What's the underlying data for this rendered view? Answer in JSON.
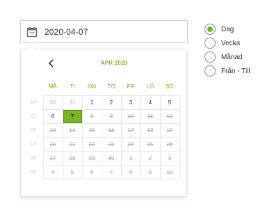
{
  "date_input": {
    "value": "2020-04-07",
    "icon": "calendar-icon"
  },
  "calendar": {
    "month_label": "APR 2020",
    "prev_icon": "chevron-left-icon",
    "weekday_headers": [
      "MÅ",
      "TI",
      "ON",
      "TO",
      "FR",
      "LÖ",
      "SÖ"
    ],
    "weeks": [
      {
        "week": "14",
        "days": [
          {
            "d": "30",
            "state": "other"
          },
          {
            "d": "31",
            "state": "other"
          },
          {
            "d": "1",
            "state": "normal"
          },
          {
            "d": "2",
            "state": "normal"
          },
          {
            "d": "3",
            "state": "normal"
          },
          {
            "d": "4",
            "state": "normal"
          },
          {
            "d": "5",
            "state": "normal"
          }
        ]
      },
      {
        "week": "15",
        "days": [
          {
            "d": "6",
            "state": "normal"
          },
          {
            "d": "7",
            "state": "selected"
          },
          {
            "d": "8",
            "state": "disabled"
          },
          {
            "d": "9",
            "state": "disabled"
          },
          {
            "d": "10",
            "state": "disabled"
          },
          {
            "d": "11",
            "state": "disabled"
          },
          {
            "d": "12",
            "state": "disabled"
          }
        ]
      },
      {
        "week": "16",
        "days": [
          {
            "d": "13",
            "state": "disabled"
          },
          {
            "d": "14",
            "state": "disabled"
          },
          {
            "d": "15",
            "state": "disabled"
          },
          {
            "d": "16",
            "state": "disabled"
          },
          {
            "d": "17",
            "state": "disabled"
          },
          {
            "d": "18",
            "state": "disabled"
          },
          {
            "d": "19",
            "state": "disabled"
          }
        ]
      },
      {
        "week": "17",
        "days": [
          {
            "d": "20",
            "state": "disabled"
          },
          {
            "d": "21",
            "state": "disabled"
          },
          {
            "d": "22",
            "state": "disabled"
          },
          {
            "d": "23",
            "state": "disabled"
          },
          {
            "d": "24",
            "state": "disabled"
          },
          {
            "d": "25",
            "state": "disabled"
          },
          {
            "d": "26",
            "state": "disabled"
          }
        ]
      },
      {
        "week": "18",
        "days": [
          {
            "d": "27",
            "state": "disabled"
          },
          {
            "d": "28",
            "state": "disabled"
          },
          {
            "d": "29",
            "state": "disabled"
          },
          {
            "d": "30",
            "state": "disabled"
          },
          {
            "d": "1",
            "state": "disabled"
          },
          {
            "d": "2",
            "state": "disabled"
          },
          {
            "d": "3",
            "state": "disabled"
          }
        ]
      },
      {
        "week": "19",
        "days": [
          {
            "d": "4",
            "state": "disabled"
          },
          {
            "d": "5",
            "state": "disabled"
          },
          {
            "d": "6",
            "state": "disabled"
          },
          {
            "d": "7",
            "state": "disabled"
          },
          {
            "d": "8",
            "state": "disabled"
          },
          {
            "d": "9",
            "state": "disabled"
          },
          {
            "d": "10",
            "state": "disabled"
          }
        ]
      }
    ]
  },
  "period_options": [
    {
      "label": "Dag",
      "selected": true
    },
    {
      "label": "Vecka",
      "selected": false
    },
    {
      "label": "Månad",
      "selected": false
    },
    {
      "label": "Från - Till",
      "selected": false
    }
  ],
  "colors": {
    "accent": "#7bb51d",
    "border": "#c9cbcf",
    "muted_text": "#b0b2b5"
  }
}
